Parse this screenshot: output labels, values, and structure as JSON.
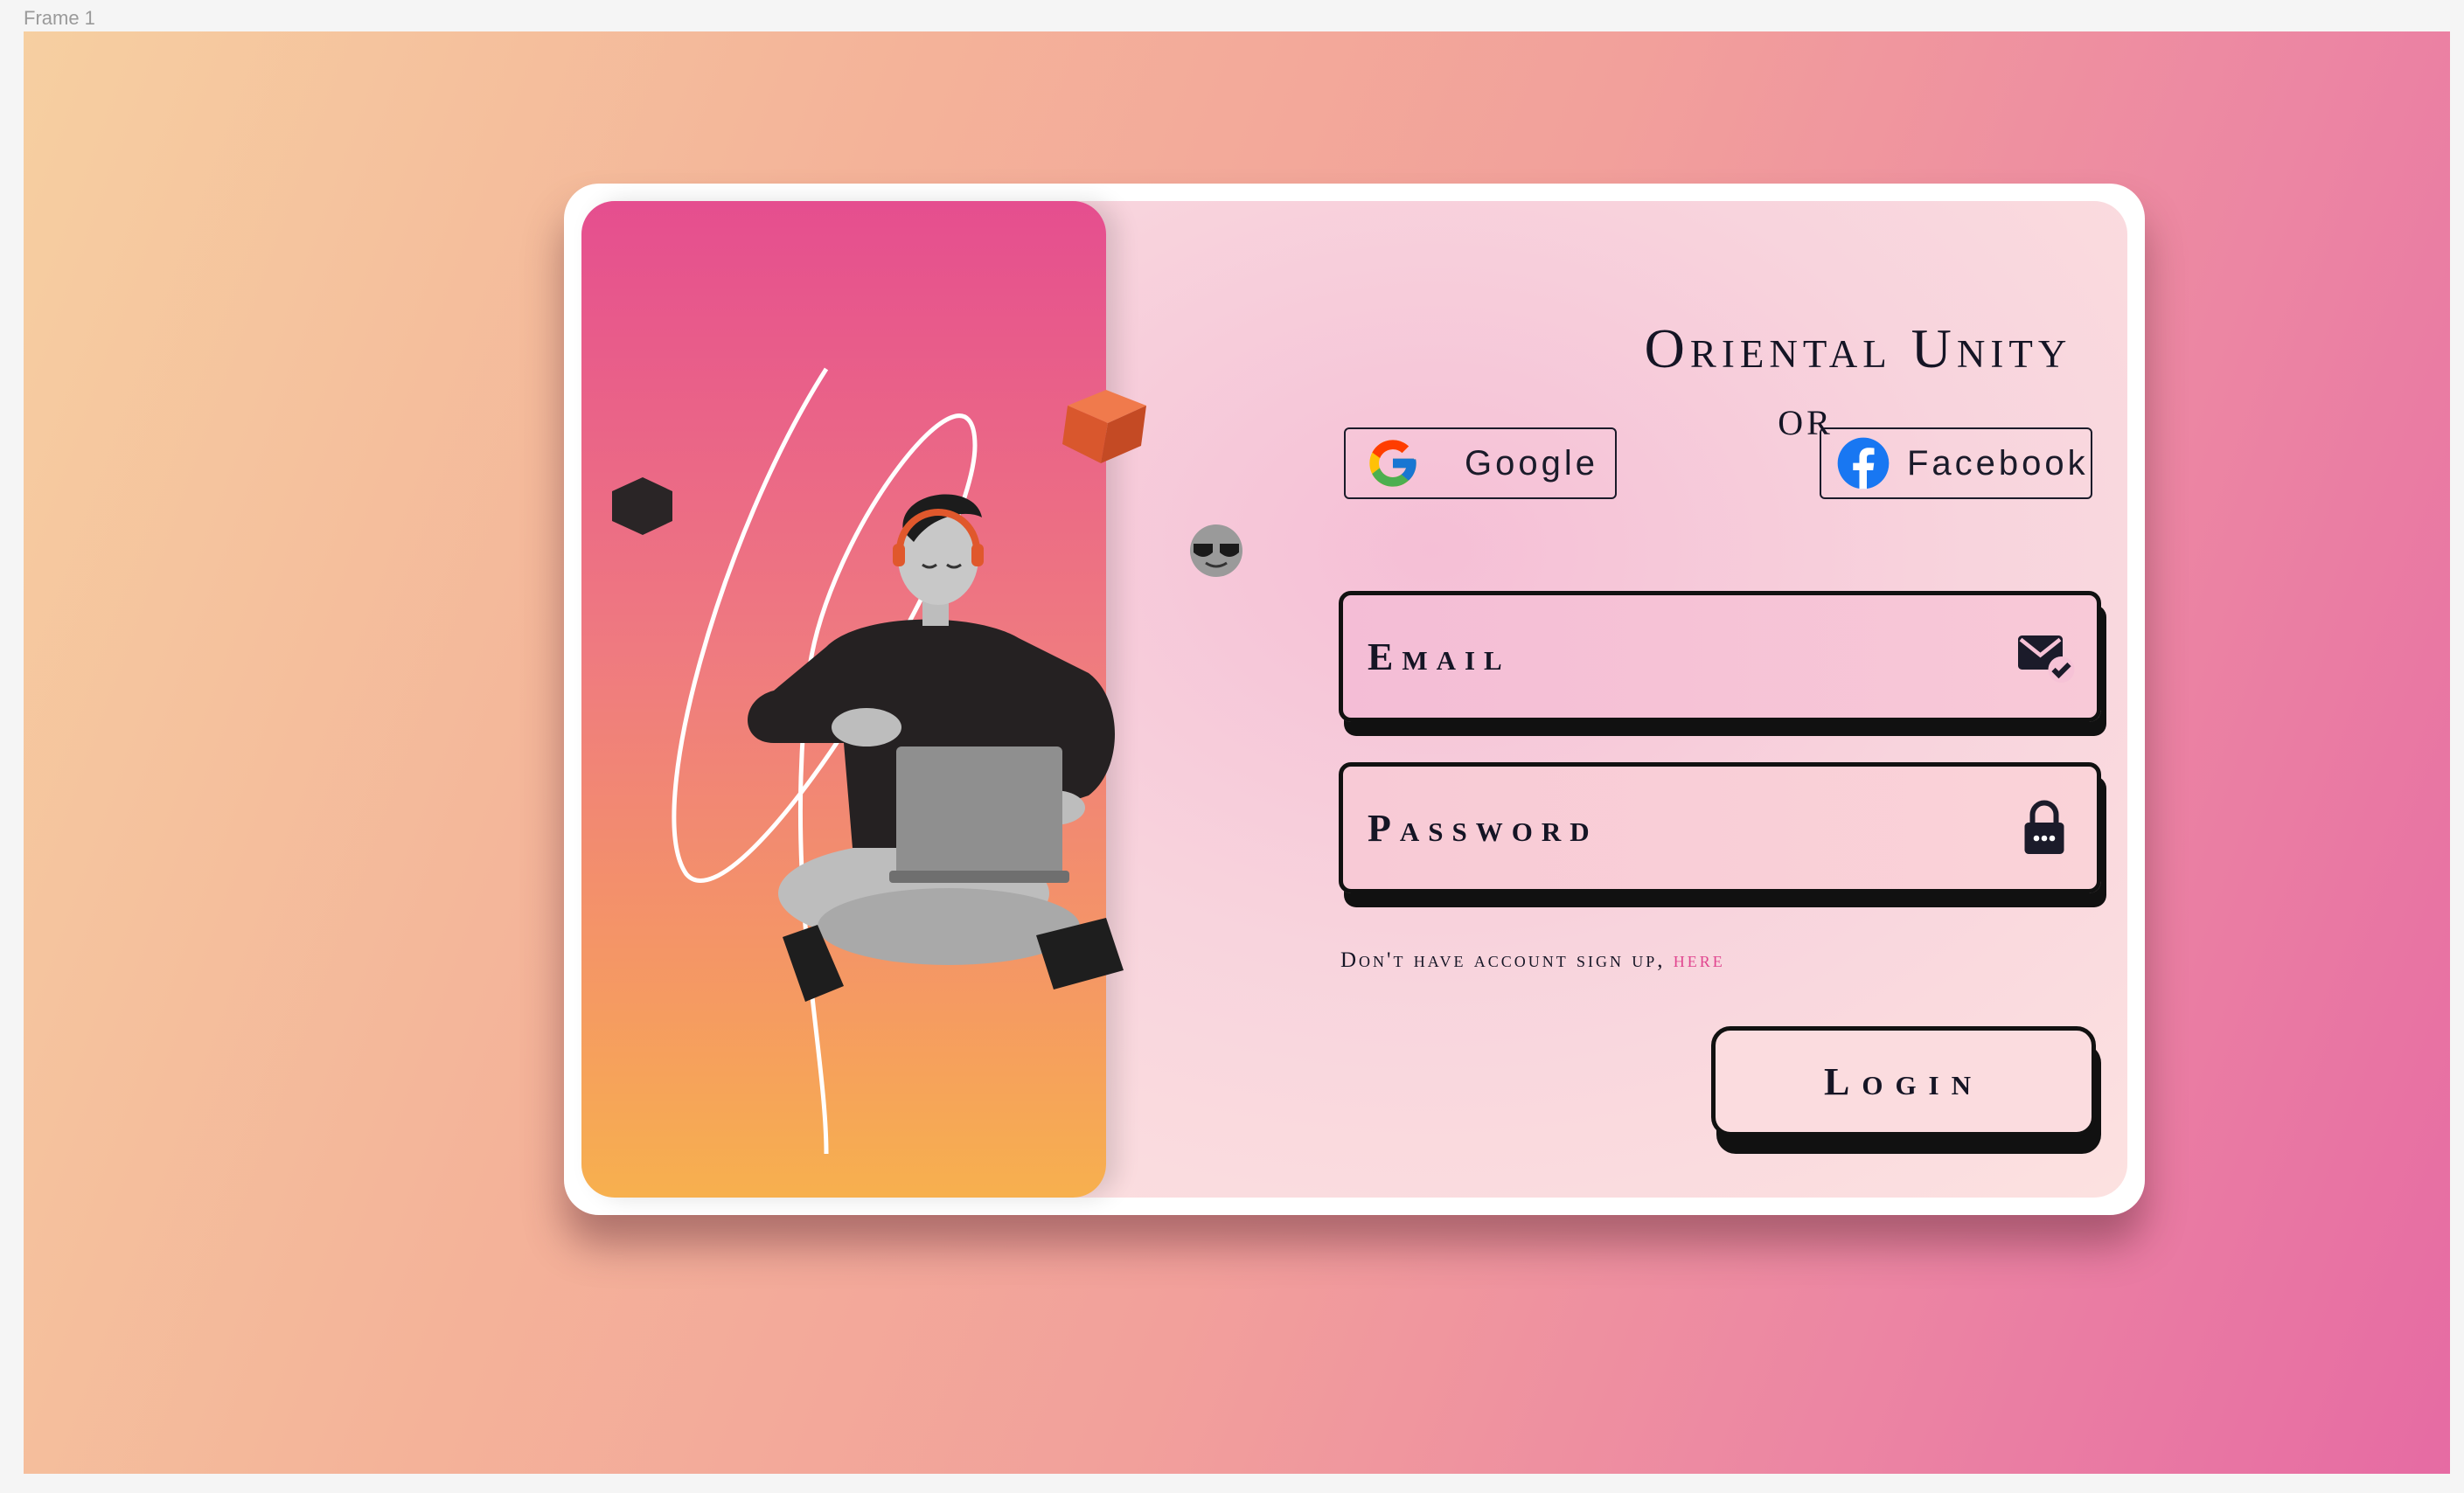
{
  "frame": {
    "label": "Frame 1"
  },
  "brand": {
    "title": "Oriental Unity"
  },
  "social": {
    "google_label": "Google",
    "facebook_label": "Facebook",
    "google_icon": "google-g-icon",
    "facebook_icon": "facebook-f-icon"
  },
  "divider": {
    "or_text": "OR"
  },
  "form": {
    "email_placeholder": "Email",
    "email_icon": "mail-check-icon",
    "password_placeholder": "Password",
    "password_icon": "lock-icon"
  },
  "signup": {
    "prompt": "Don't have account sign up, ",
    "link_label": "here"
  },
  "login": {
    "label": "Login"
  },
  "colors": {
    "accent_pink": "#e0458f",
    "text_dark": "#151525",
    "panel_top": "#e54e8f",
    "panel_bottom": "#f7b04e"
  }
}
